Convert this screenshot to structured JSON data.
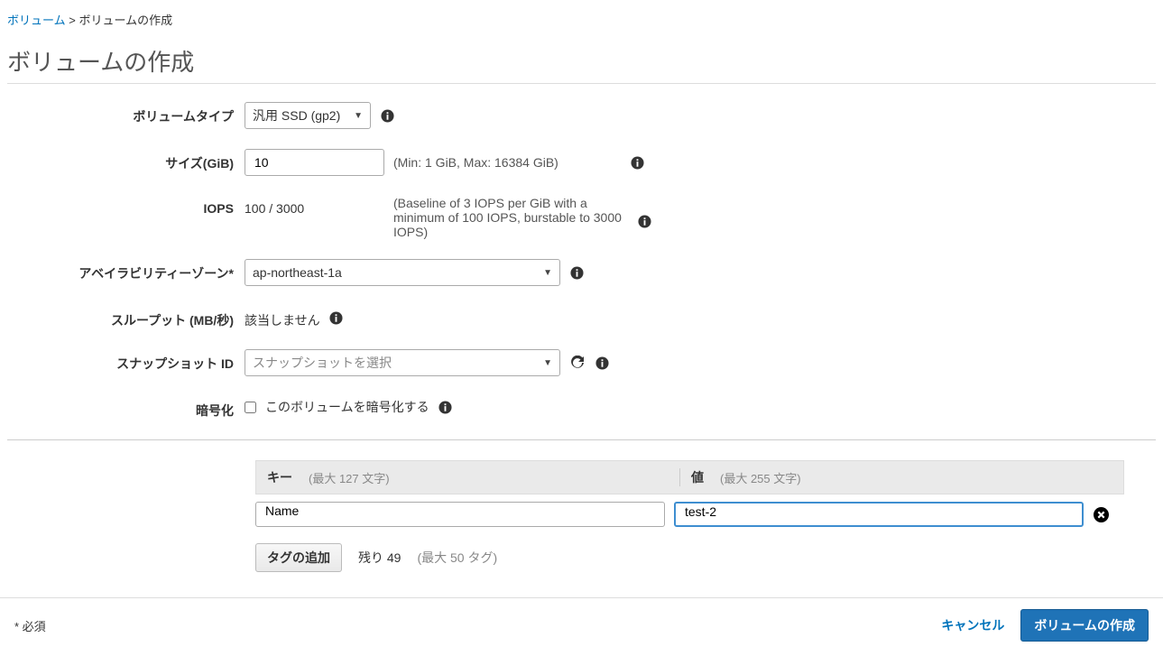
{
  "breadcrumb": {
    "parent": "ボリューム",
    "sep": ">",
    "current": "ボリュームの作成"
  },
  "page_title": "ボリュームの作成",
  "form": {
    "volume_type": {
      "label": "ボリュームタイプ",
      "selected": "汎用 SSD (gp2)"
    },
    "size": {
      "label": "サイズ(GiB)",
      "value": "10",
      "hint": "(Min: 1 GiB, Max: 16384 GiB)"
    },
    "iops": {
      "label": "IOPS",
      "value": "100 / 3000",
      "hint": "(Baseline of 3 IOPS per GiB with a minimum of 100 IOPS, burstable to 3000 IOPS)"
    },
    "az": {
      "label": "アベイラビリティーゾーン*",
      "selected": "ap-northeast-1a"
    },
    "throughput": {
      "label": "スループット (MB/秒)",
      "value": "該当しません"
    },
    "snapshot": {
      "label": "スナップショット ID",
      "placeholder": "スナップショットを選択"
    },
    "encrypt": {
      "label": "暗号化",
      "text": "このボリュームを暗号化する"
    }
  },
  "tags": {
    "header_key": "キー",
    "header_key_hint": "(最大 127 文字)",
    "header_value": "値",
    "header_value_hint": "(最大 255 文字)",
    "rows": [
      {
        "key": "Name",
        "value": "test-2"
      }
    ],
    "add_button": "タグの追加",
    "remaining": "残り 49",
    "max_hint": "(最大 50 タグ)"
  },
  "footer": {
    "required": "* 必須",
    "cancel": "キャンセル",
    "submit": "ボリュームの作成"
  }
}
